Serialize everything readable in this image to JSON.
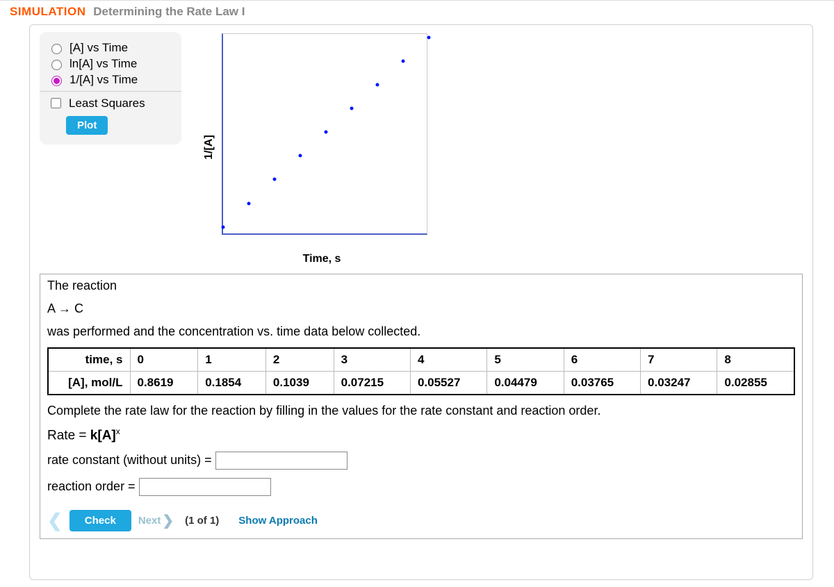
{
  "header": {
    "sim": "SIMULATION",
    "title": "Determining the Rate Law I"
  },
  "controls": {
    "opt_a": "[A] vs Time",
    "opt_lna": "ln[A] vs Time",
    "opt_inva": "1/[A] vs Time",
    "selected": "opt_inva",
    "least_squares": "Least Squares",
    "plot": "Plot"
  },
  "chart_data": {
    "type": "scatter",
    "xlabel": "Time, s",
    "ylabel": "1/[A]",
    "x": [
      0,
      1,
      2,
      3,
      4,
      5,
      6,
      7,
      8
    ],
    "y": [
      1.16,
      5.394,
      9.625,
      13.86,
      18.093,
      22.326,
      26.56,
      30.798,
      35.026
    ],
    "xlim": [
      0,
      8
    ],
    "ylim": [
      0,
      36
    ]
  },
  "question": {
    "line1": "The reaction",
    "eqn": "A → C",
    "line2": "was performed and the concentration vs. time data below collected.",
    "table": {
      "row1_label": "time, s",
      "row2_label": "[A], mol/L",
      "times": [
        "0",
        "1",
        "2",
        "3",
        "4",
        "5",
        "6",
        "7",
        "8"
      ],
      "conc": [
        "0.8619",
        "0.1854",
        "0.1039",
        "0.07215",
        "0.05527",
        "0.04479",
        "0.03765",
        "0.03247",
        "0.02855"
      ]
    },
    "instr": "Complete the rate law for the reaction by filling in the values for the rate constant and reaction order.",
    "rate_prefix": "Rate = ",
    "rate_bold": "k[A]",
    "rate_sup": "x",
    "k_label": "rate constant (without units) = ",
    "order_label": "reaction order = "
  },
  "footer": {
    "check": "Check",
    "next": "Next",
    "counter": "(1 of 1)",
    "show_approach": "Show Approach"
  }
}
